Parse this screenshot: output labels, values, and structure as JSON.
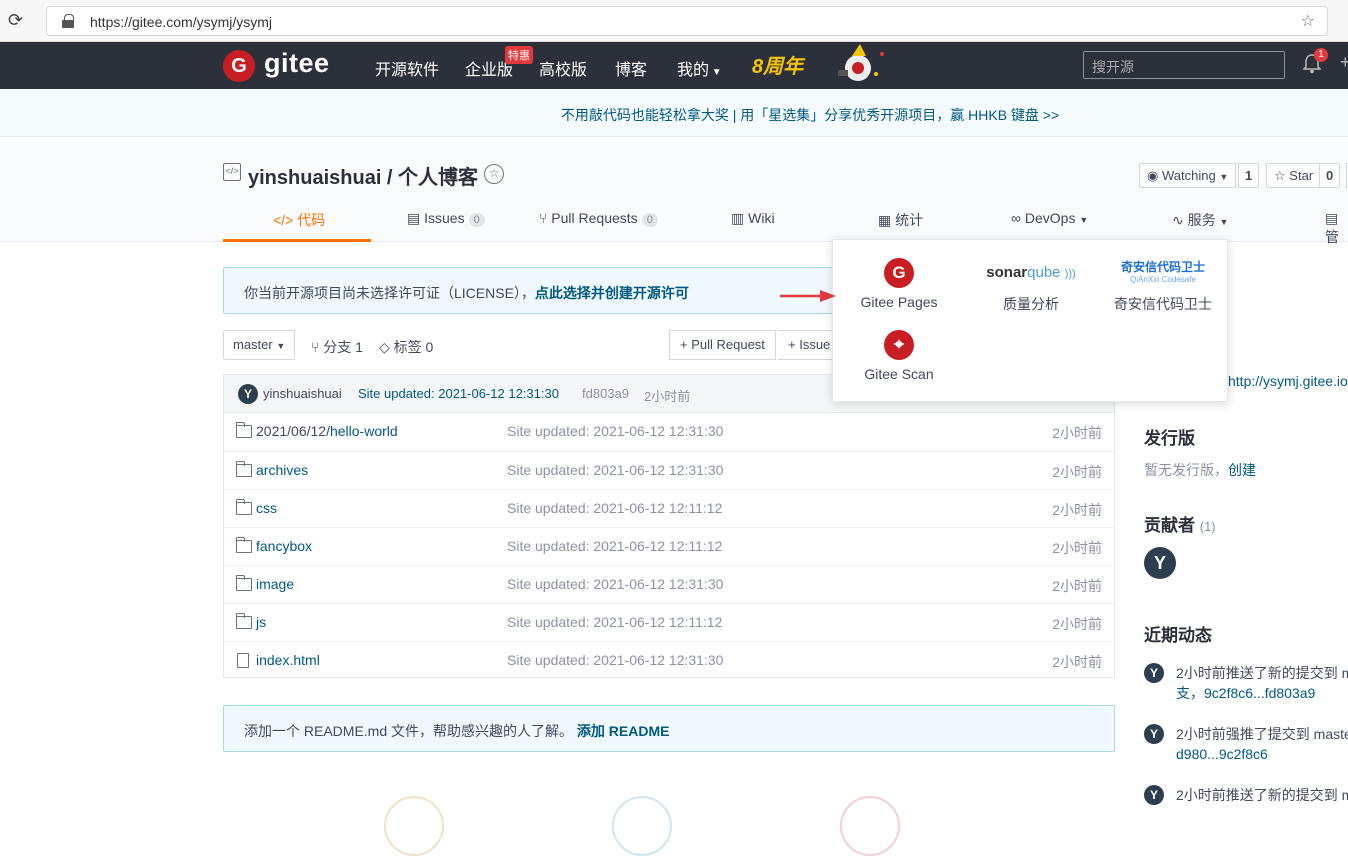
{
  "browser": {
    "url": "https://gitee.com/ysymj/ysymj"
  },
  "nav": {
    "logo": "gitee",
    "items": [
      "开源软件",
      "企业版",
      "高校版",
      "博客",
      "我的"
    ],
    "hot_badge": "特惠",
    "anniversary": "8周年",
    "search_placeholder": "搜开源",
    "notif_count": "1"
  },
  "banner": {
    "text": "不用敲代码也能轻松拿大奖 | 用「星选集」分享优秀开源项目，赢 HHKB 键盘 >>"
  },
  "repo": {
    "title": "yinshuaishuai / 个人博客",
    "watching_label": "Watching",
    "watching_count": "1",
    "star_label": "Star",
    "star_count": "0"
  },
  "tabs": [
    {
      "label": "代码",
      "icon": "code-icon"
    },
    {
      "label": "Issues",
      "count": "0"
    },
    {
      "label": "Pull Requests",
      "count": "0"
    },
    {
      "label": "Wiki"
    },
    {
      "label": "统计"
    },
    {
      "label": "DevOps"
    },
    {
      "label": "服务"
    },
    {
      "label": "管"
    }
  ],
  "services_menu": [
    {
      "label": "Gitee Pages",
      "icon": "gitee-pages-icon"
    },
    {
      "label": "质量分析",
      "logo_text": "sonarqube"
    },
    {
      "label": "奇安信代码卫士",
      "logo_text": "奇安信代码卫士",
      "logo_sub": "QiAnXin Codesafe"
    },
    {
      "label": "Gitee Scan",
      "icon": "gitee-scan-icon"
    }
  ],
  "license_notice": {
    "text": "你当前开源项目尚未选择许可证（LICENSE），",
    "link": "点此选择并创建开源许可"
  },
  "branch": {
    "current": "master",
    "branches": "分支 1",
    "tags": "标签 0",
    "pr_button": "+ Pull Request",
    "issue_button": "+ Issue"
  },
  "last_commit": {
    "avatar": "Y",
    "author": "yinshuaishuai",
    "message": "Site updated: 2021-06-12 12:31:30",
    "hash": "fd803a9",
    "time": "2小时前"
  },
  "files": [
    {
      "prefix": "2021/06/12/",
      "name": "hello-world",
      "type": "folder",
      "message": "Site updated: 2021-06-12 12:31:30",
      "time": "2小时前"
    },
    {
      "prefix": "",
      "name": "archives",
      "type": "folder",
      "message": "Site updated: 2021-06-12 12:31:30",
      "time": "2小时前"
    },
    {
      "prefix": "",
      "name": "css",
      "type": "folder",
      "message": "Site updated: 2021-06-12 12:11:12",
      "time": "2小时前"
    },
    {
      "prefix": "",
      "name": "fancybox",
      "type": "folder",
      "message": "Site updated: 2021-06-12 12:11:12",
      "time": "2小时前"
    },
    {
      "prefix": "",
      "name": "image",
      "type": "folder",
      "message": "Site updated: 2021-06-12 12:31:30",
      "time": "2小时前"
    },
    {
      "prefix": "",
      "name": "js",
      "type": "folder",
      "message": "Site updated: 2021-06-12 12:11:12",
      "time": "2小时前"
    },
    {
      "prefix": "",
      "name": "index.html",
      "type": "file",
      "message": "Site updated: 2021-06-12 12:31:30",
      "time": "2小时前"
    }
  ],
  "readme_notice": {
    "text": "添加一个 README.md 文件，帮助感兴趣的人了解。",
    "link": "添加 README"
  },
  "sidebar": {
    "site_url": "http://ysymj.gitee.io",
    "releases_title": "发行版",
    "releases_text": "暂无发行版，",
    "releases_link": "创建",
    "contributors_title": "贡献者",
    "contributors_count": "(1)",
    "contributor_avatar": "Y",
    "activity_title": "近期动态",
    "activities": [
      {
        "avatar": "Y",
        "text": "2小时前推送了新的提交到 m",
        "link": "支，9c2f8c6...fd803a9"
      },
      {
        "avatar": "Y",
        "text": "2小时前强推了提交到 maste",
        "link": "d980...9c2f8c6"
      },
      {
        "avatar": "Y",
        "text": "2小时前推送了新的提交到 m",
        "link": ""
      }
    ]
  },
  "colors": {
    "nav_bg": "#2c303a",
    "accent": "#fe7300",
    "brand_red": "#c71d23",
    "link": "#005980"
  }
}
